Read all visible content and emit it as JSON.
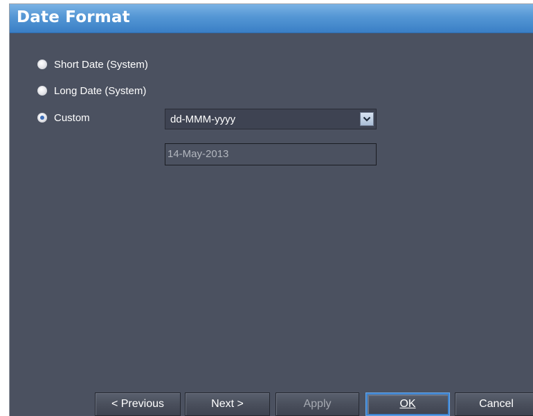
{
  "dialog": {
    "title": "Date Format"
  },
  "options": [
    {
      "label": "Short Date (System)",
      "checked": false
    },
    {
      "label": "Long Date (System)",
      "checked": false
    },
    {
      "label": "Custom",
      "checked": true
    }
  ],
  "custom_format": {
    "selected_value": "dd-MMM-yyyy",
    "preview_value": "14-May-2013"
  },
  "buttons": {
    "previous": "< Previous",
    "next": "Next >",
    "apply": "Apply",
    "ok": "OK",
    "cancel": "Cancel"
  },
  "icons": {
    "dropdown": "chevron-down-icon"
  },
  "colors": {
    "background": "#4b5160",
    "title_bar": "#5496d4",
    "text": "#ffffff",
    "disabled_text": "#b3b7bf"
  }
}
